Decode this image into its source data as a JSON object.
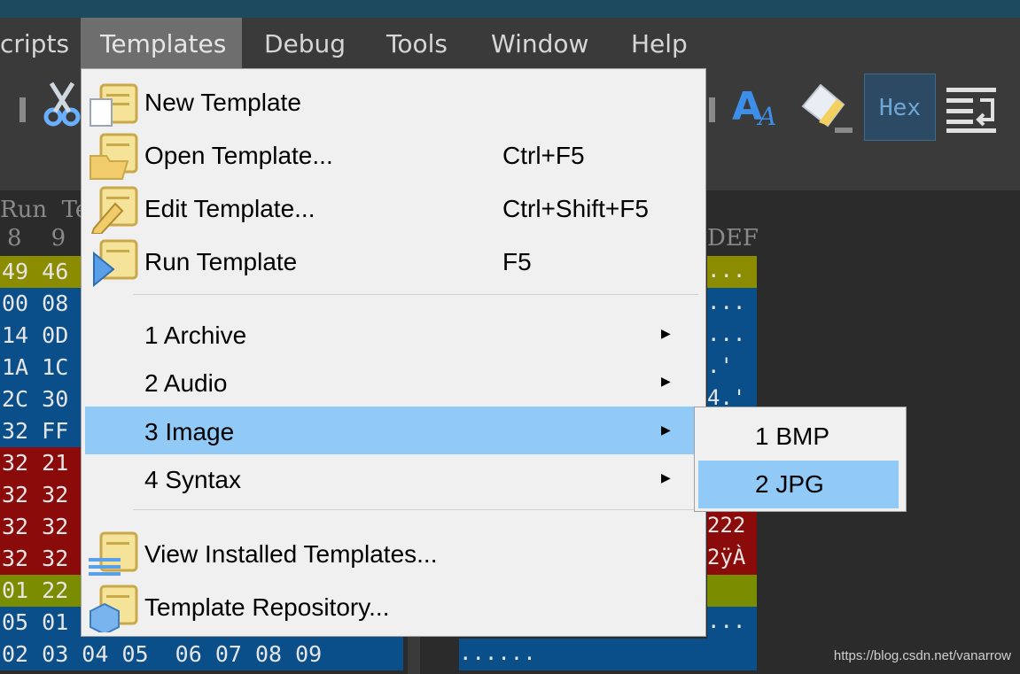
{
  "menubar": {
    "items": [
      "cripts",
      "Templates",
      "Debug",
      "Tools",
      "Window",
      "Help"
    ]
  },
  "toolbar": {
    "hex_label": "Hex"
  },
  "hex_header": {
    "left": "Run  Ter",
    "cols": "8    9",
    "right": "DEF"
  },
  "hex_rows": [
    {
      "text": "49 46",
      "color": "#8c8c00"
    },
    {
      "text": "00 08",
      "color": "#0a4f8a"
    },
    {
      "text": "14 0D",
      "color": "#0a4f8a"
    },
    {
      "text": "1A 1C",
      "color": "#0a4f8a"
    },
    {
      "text": "2C 30",
      "color": "#0a4f8a"
    },
    {
      "text": "32 FF",
      "color": "#0a4f8a"
    },
    {
      "text": "32 21",
      "color": "#8b0a0a"
    },
    {
      "text": "32 32",
      "color": "#8b0a0a"
    },
    {
      "text": "32 32",
      "color": "#8b0a0a"
    },
    {
      "text": "32 32",
      "color": "#8b0a0a"
    },
    {
      "text": "01 22",
      "color": "#7a8c00"
    },
    {
      "text": "05 01",
      "color": "#0a4f8a"
    },
    {
      "text": "02 03 04 05  06 07 08 09",
      "color": "#0a4f8a"
    }
  ],
  "right_rows": [
    "...",
    "...",
    "...",
    ".'",
    "4.'",
    "",
    "",
    "",
    "222",
    "2ÿÀ",
    "",
    "...",
    "......"
  ],
  "dropdown": {
    "items": [
      {
        "label": "New Template",
        "shortcut": "",
        "icon": "new-template-icon"
      },
      {
        "label": "Open Template...",
        "shortcut": "Ctrl+F5",
        "icon": "open-template-icon"
      },
      {
        "label": "Edit Template...",
        "shortcut": "Ctrl+Shift+F5",
        "icon": "edit-template-icon"
      },
      {
        "label": "Run Template",
        "shortcut": "F5",
        "icon": "run-template-icon"
      }
    ],
    "categories": [
      {
        "label": "1 Archive"
      },
      {
        "label": "2 Audio"
      },
      {
        "label": "3 Image"
      },
      {
        "label": "4 Syntax"
      }
    ],
    "footer": [
      {
        "label": "View Installed Templates...",
        "icon": "view-installed-icon"
      },
      {
        "label": "Template Repository...",
        "icon": "template-repository-icon"
      }
    ]
  },
  "submenu": {
    "items": [
      "1 BMP",
      "2 JPG"
    ],
    "selected": "2 JPG"
  },
  "watermark": "https://blog.csdn.net/vanarrow",
  "colors": {
    "highlight": "#91c9f7",
    "menu_bg": "#f0f0f0",
    "dark_bg": "#2b2b2b"
  }
}
